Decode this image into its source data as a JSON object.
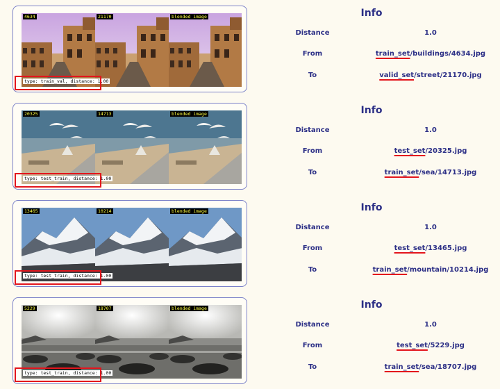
{
  "info_title": "Info",
  "labels": {
    "distance": "Distance",
    "from": "From",
    "to": "To",
    "blended": "blended image"
  },
  "rows": [
    {
      "id_a": "4634",
      "id_b": "21170",
      "caption": "type: train_val, distance: 1.00",
      "distance": "1.0",
      "from_split": "train_set",
      "from_path": "/buildings/4634.jpg",
      "to_split": "valid_set",
      "to_path": "/street/21170.jpg",
      "scene": "buildings"
    },
    {
      "id_a": "20325",
      "id_b": "14713",
      "caption": "type: test_train, distance: 1.00",
      "distance": "1.0",
      "from_split": "test_set",
      "from_path": "/20325.jpg",
      "to_split": "train_set",
      "to_path": "/sea/14713.jpg",
      "scene": "sea-birds"
    },
    {
      "id_a": "13465",
      "id_b": "10214",
      "caption": "type: test_train, distance: 1.00",
      "distance": "1.0",
      "from_split": "test_set",
      "from_path": "/13465.jpg",
      "to_split": "train_set",
      "to_path": "/mountain/10214.jpg",
      "scene": "mountain"
    },
    {
      "id_a": "5229",
      "id_b": "18707",
      "caption": "type: test_train, distance: 1.00",
      "distance": "1.0",
      "from_split": "test_set",
      "from_path": "/5229.jpg",
      "to_split": "train_set",
      "to_path": "/sea/18707.jpg",
      "scene": "sea-rocks"
    }
  ],
  "colors": {
    "page_bg": "#fdfaf0",
    "card_border": "#7a80c8",
    "info_text": "#2c2f86",
    "highlight_red": "#e3151c",
    "label_text_yellow": "#ffff44"
  }
}
